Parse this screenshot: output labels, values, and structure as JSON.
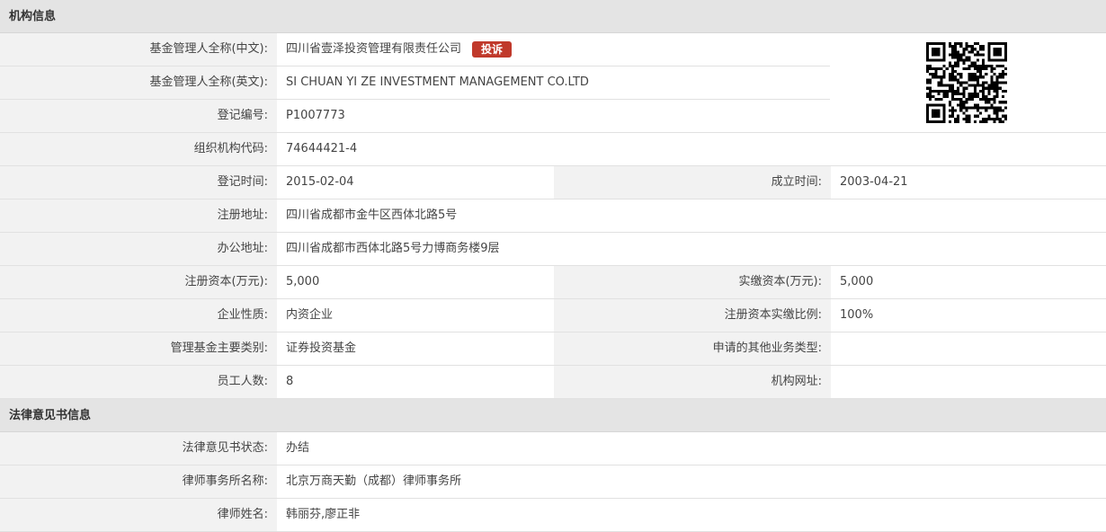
{
  "section1": {
    "title": "机构信息",
    "rows": [
      {
        "label": "基金管理人全称(中文):",
        "value": "四川省壹泽投资管理有限责任公司",
        "badge": "投诉"
      },
      {
        "label": "基金管理人全称(英文):",
        "value": "SI CHUAN YI ZE INVESTMENT MANAGEMENT CO.LTD"
      },
      {
        "label": "登记编号:",
        "value": "P1007773"
      },
      {
        "label": "组织机构代码:",
        "value": "74644421-4"
      },
      {
        "label": "登记时间:",
        "value": "2015-02-04",
        "label2": "成立时间:",
        "value2": "2003-04-21"
      },
      {
        "label": "注册地址:",
        "value": "四川省成都市金牛区西体北路5号"
      },
      {
        "label": "办公地址:",
        "value": "四川省成都市西体北路5号力博商务楼9层"
      },
      {
        "label": "注册资本(万元):",
        "value": "5,000",
        "label2": "实缴资本(万元):",
        "value2": "5,000"
      },
      {
        "label": "企业性质:",
        "value": "内资企业",
        "label2": "注册资本实缴比例:",
        "value2": "100%"
      },
      {
        "label": "管理基金主要类别:",
        "value": "证券投资基金",
        "label2": "申请的其他业务类型:",
        "value2": ""
      },
      {
        "label": "员工人数:",
        "value": "8",
        "label2": "机构网址:",
        "value2": ""
      }
    ]
  },
  "section2": {
    "title": "法律意见书信息",
    "rows": [
      {
        "label": "法律意见书状态:",
        "value": "办结"
      },
      {
        "label": "律师事务所名称:",
        "value": "北京万商天勤（成都）律师事务所"
      },
      {
        "label": "律师姓名:",
        "value": "韩丽芬,廖正非"
      }
    ]
  },
  "qr": {
    "icon": "qr-code-icon"
  }
}
